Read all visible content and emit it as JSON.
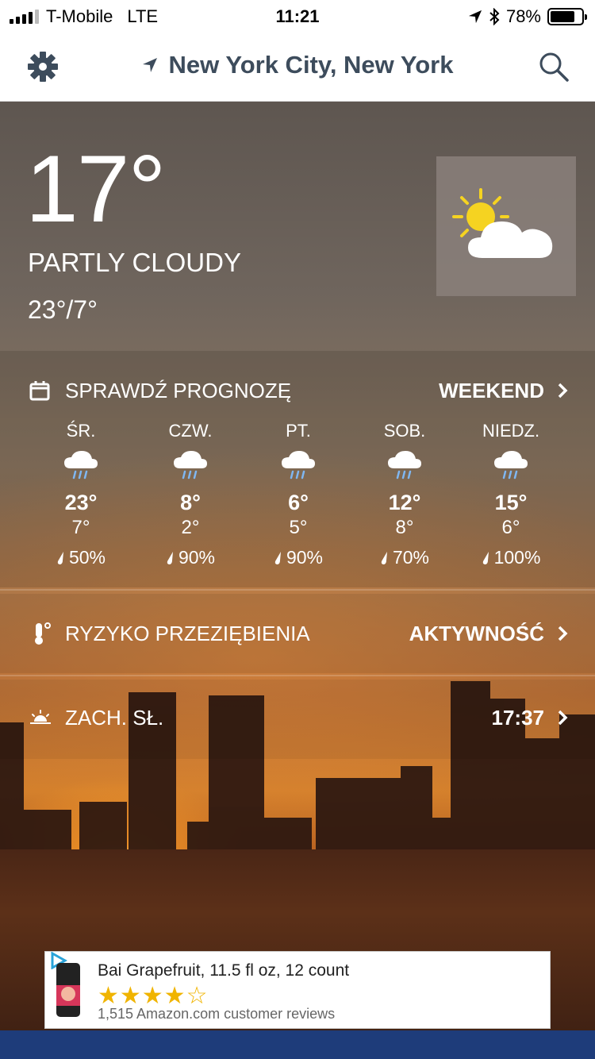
{
  "status_bar": {
    "carrier": "T-Mobile",
    "network": "LTE",
    "time": "11:21",
    "battery": "78%",
    "battery_level": 0.78
  },
  "header": {
    "location": "New York City, New York",
    "icons": [
      "gear-icon",
      "location-arrow-icon",
      "search-icon"
    ]
  },
  "current": {
    "temperature": "17°",
    "condition": "PARTLY CLOUDY",
    "hi_lo": "23°/7°",
    "icon": "partly-cloudy-icon"
  },
  "forecast": {
    "label": "SPRAWDŹ PROGNOZĘ",
    "link": "WEEKEND",
    "days": [
      {
        "name": "ŚR.",
        "hi": "23°",
        "lo": "7°",
        "precip": "50%"
      },
      {
        "name": "CZW.",
        "hi": "8°",
        "lo": "2°",
        "precip": "90%"
      },
      {
        "name": "PT.",
        "hi": "6°",
        "lo": "5°",
        "precip": "90%"
      },
      {
        "name": "SOB.",
        "hi": "12°",
        "lo": "8°",
        "precip": "70%"
      },
      {
        "name": "NIEDZ.",
        "hi": "15°",
        "lo": "6°",
        "precip": "100%"
      }
    ]
  },
  "cold_risk": {
    "label": "RYZYKO PRZEZIĘBIENIA",
    "link": "AKTYWNOŚĆ"
  },
  "sunset": {
    "label": "ZACH. SŁ.",
    "time": "17:37"
  },
  "ad": {
    "title": "Bai Grapefruit, 11.5 fl oz, 12 count",
    "stars": "★★★★☆",
    "rating": 4,
    "reviews": "1,515 Amazon.com customer reviews"
  },
  "colors": {
    "header_text": "#3d4c5c",
    "sun": "#f5d321",
    "accent_blue": "#1e3c7a"
  }
}
